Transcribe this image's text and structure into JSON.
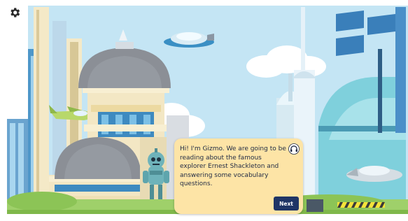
{
  "settings": {
    "icon": "gear-icon"
  },
  "dialog": {
    "message": "Hi! I'm Gizmo. We are going to be reading about the famous explorer Ernest Shackleton and answering some vocabulary questions.",
    "audio_icon": "headphones-icon",
    "next_label": "Next"
  },
  "character": {
    "name": "Gizmo"
  },
  "colors": {
    "sky": "#bfe2f3",
    "dialog_bg": "#fde4a6",
    "dialog_text": "#1f2a44",
    "next_button": "#1f3566",
    "dome": "#8b8f96",
    "building_cream": "#f3e7c4",
    "tower_teal": "#7fd0dc"
  }
}
